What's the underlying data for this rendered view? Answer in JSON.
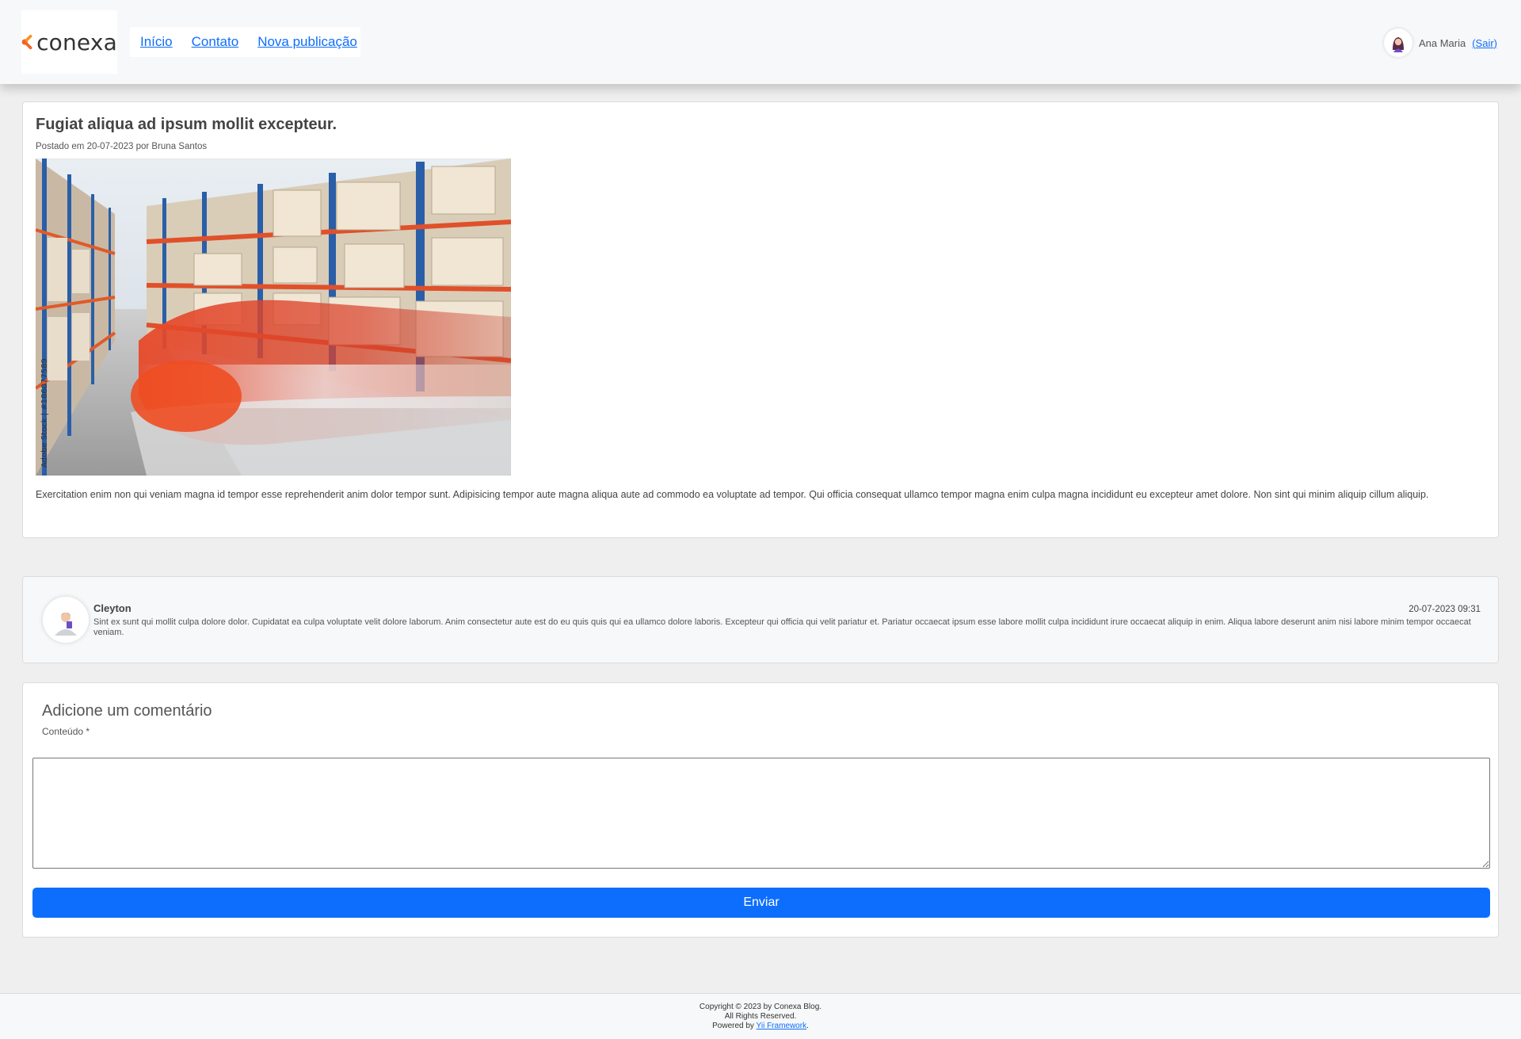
{
  "brand": {
    "name": "conexa",
    "accent_color": "#f26522"
  },
  "nav": {
    "items": [
      "Início",
      "Contato",
      "Nova publicação"
    ]
  },
  "user": {
    "name": "Ana Maria",
    "logout_label": "(Sair)"
  },
  "post": {
    "title": "Fugiat aliqua ad ipsum mollit excepteur.",
    "meta": "Postado em 20-07-2023 por Bruna Santos",
    "image_watermark": "Adobe Stock | #186077589",
    "body": "Exercitation enim non qui veniam magna id tempor esse reprehenderit anim dolor tempor sunt. Adipisicing tempor aute magna aliqua aute ad commodo ea voluptate ad tempor. Qui officia consequat ullamco tempor magna enim culpa magna incididunt eu excepteur amet dolore. Non sint qui minim aliquip cillum aliquip."
  },
  "comments": [
    {
      "author": "Cleyton",
      "date": "20-07-2023 09:31",
      "text": "Sint ex sunt qui mollit culpa dolore dolor. Cupidatat ea culpa voluptate velit dolore laborum. Anim consectetur aute est do eu quis quis qui ea ullamco dolore laboris. Excepteur qui officia qui velit pariatur et. Pariatur occaecat ipsum esse labore mollit culpa incididunt irure occaecat aliquip in enim. Aliqua labore deserunt anim nisi labore minim tempor occaecat veniam."
    }
  ],
  "form": {
    "title": "Adicione um comentário",
    "label": "Conteúdo *",
    "textarea_value": "",
    "submit_label": "Enviar"
  },
  "footer": {
    "line1": "Copyright © 2023 by Conexa Blog.",
    "line2": "All Rights Reserved.",
    "powered_prefix": "Powered by",
    "powered_link": "Yii Framework",
    "powered_suffix": "."
  },
  "colors": {
    "primary": "#0d6efd",
    "background": "#efefef",
    "card": "#ffffff"
  }
}
